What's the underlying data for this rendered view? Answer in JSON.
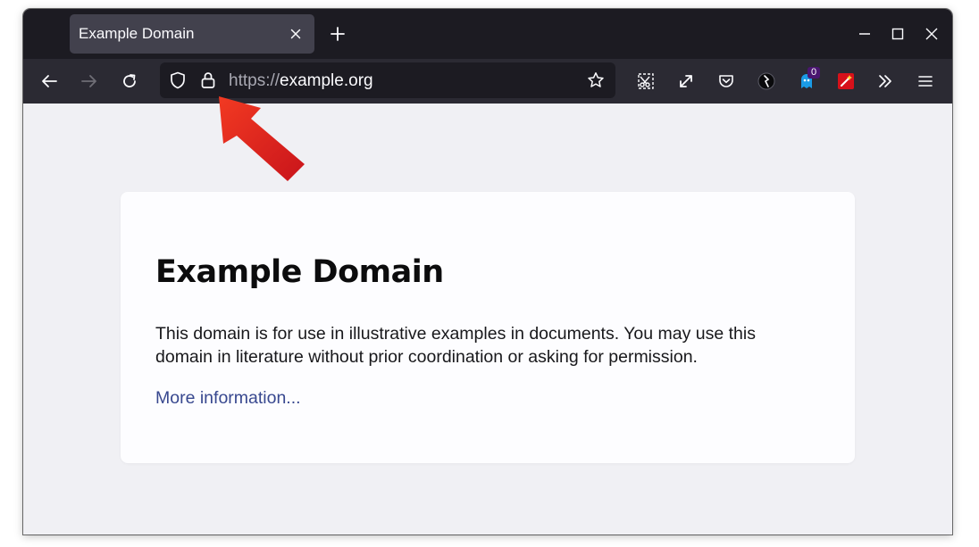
{
  "browser": {
    "tab": {
      "title": "Example Domain",
      "close_icon": "close-icon"
    },
    "new_tab_icon": "plus-icon",
    "window_controls": [
      "minimize-icon",
      "maximize-icon",
      "close-icon"
    ],
    "nav": {
      "back_icon": "back-arrow-icon",
      "forward_icon": "forward-arrow-icon",
      "reload_icon": "reload-icon"
    },
    "urlbar": {
      "shield_icon": "tracking-protection-shield-icon",
      "lock_icon": "padlock-icon",
      "url_scheme": "https://",
      "url_host": "example.org",
      "bookmark_icon": "star-icon"
    },
    "toolbar": {
      "extensions": [
        "screenshot-icon",
        "expand-icon",
        "pocket-icon",
        "dark-extension-icon",
        "notification-extension-icon",
        "red-wand-extension-icon"
      ],
      "notification_badge": "0",
      "overflow_icon": "chevron-double-right-icon",
      "menu_icon": "hamburger-menu-icon"
    },
    "colors": {
      "tabstrip": "#1c1b22",
      "navbar": "#2b2a33",
      "page_background": "#f0f0f4",
      "link": "#38488f",
      "annotation_arrow": "#e8251c"
    }
  },
  "page": {
    "heading": "Example Domain",
    "paragraph": "This domain is for use in illustrative examples in documents. You may use this domain in literature without prior coordination or asking for permission.",
    "link_text": "More information..."
  }
}
